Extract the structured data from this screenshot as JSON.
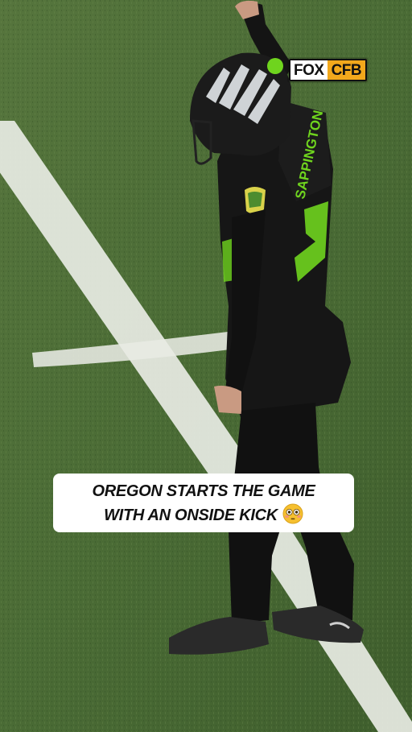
{
  "broadcast_logo": {
    "part1": "FOX",
    "part2": "CFB",
    "colors": {
      "fox_bg": "#ffffff",
      "cfb_bg": "#f2a81c"
    }
  },
  "caption": {
    "line1": "OREGON STARTS THE GAME",
    "line2": "WITH AN ONSIDE KICK",
    "emoji": "flushed-face-emoji"
  },
  "player": {
    "jersey_name": "SAPPINGTON",
    "uniform_color": "#141414",
    "accent_color": "#6fd41e"
  },
  "colors": {
    "turf": "#4a6a34",
    "field_line": "#e8ebe4"
  }
}
